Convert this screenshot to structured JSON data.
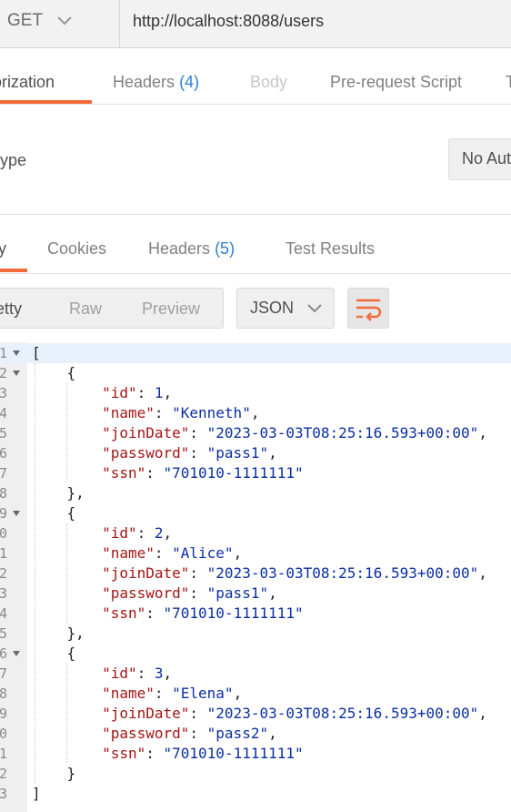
{
  "request": {
    "method": "GET",
    "url": "http://localhost:8088/users"
  },
  "request_tabs": [
    {
      "label": "Authorization",
      "visible_text": "horization"
    },
    {
      "label": "Headers",
      "count": "(4)"
    },
    {
      "label": "Body"
    },
    {
      "label": "Pre-request Script"
    },
    {
      "label": "Tests",
      "visible_text": "T"
    }
  ],
  "auth": {
    "type_label_visible": "ype",
    "type_value_visible": "No Aut"
  },
  "response_tabs": [
    {
      "label": "Body",
      "visible_text": "y"
    },
    {
      "label": "Cookies"
    },
    {
      "label": "Headers",
      "count": "(5)"
    },
    {
      "label": "Test Results"
    }
  ],
  "view_modes": [
    {
      "label": "Pretty",
      "visible_text": "etty"
    },
    {
      "label": "Raw"
    },
    {
      "label": "Preview"
    }
  ],
  "format": "JSON",
  "line_numbers_visible": [
    "1",
    "2",
    "3",
    "4",
    "5",
    "6",
    "7",
    "8",
    "9",
    "0",
    "1",
    "2",
    "3",
    "4",
    "5",
    "6",
    "7",
    "8",
    "9",
    "0",
    "1",
    "2",
    "3"
  ],
  "users": [
    {
      "id": 1,
      "name": "Kenneth",
      "joinDate": "2023-03-03T08:25:16.593+00:00",
      "password": "pass1",
      "ssn": "701010-1111111"
    },
    {
      "id": 2,
      "name": "Alice",
      "joinDate": "2023-03-03T08:25:16.593+00:00",
      "password": "pass1",
      "ssn": "701010-1111111"
    },
    {
      "id": 3,
      "name": "Elena",
      "joinDate": "2023-03-03T08:25:16.593+00:00",
      "password": "pass2",
      "ssn": "701010-1111111"
    }
  ],
  "colors": {
    "accent": "#f26b3a",
    "count": "#2f7fd6",
    "json_key": "#a31515",
    "json_value": "#0b2fa3"
  }
}
